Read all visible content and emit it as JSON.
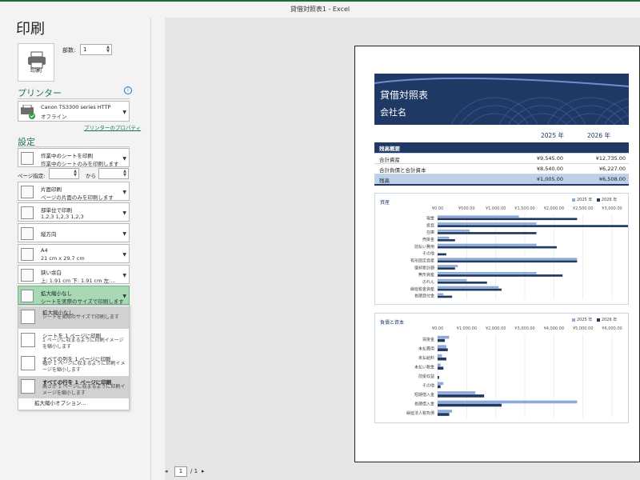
{
  "window": {
    "title": "貸借対照表1  -  Excel"
  },
  "left": {
    "heading": "印刷",
    "print_button": "印刷",
    "copies_label": "部数:",
    "copies_value": "1",
    "printer_heading": "プリンター",
    "printer_name": "Canon TS3300 series HTTP",
    "printer_status": "オフライン",
    "printer_props": "プリンターのプロパティ",
    "settings_heading": "設定",
    "pages_label": "ページ指定:",
    "pages_to": "から",
    "settings": [
      {
        "l1": "作業中のシートを印刷",
        "l2": "作業中のシートのみを印刷します"
      },
      {
        "l1": "片面印刷",
        "l2": "ページの片面のみを印刷します"
      },
      {
        "l1": "部単位で印刷",
        "l2": "1,2,3    1,2,3    1,2,3"
      },
      {
        "l1": "縦方向",
        "l2": ""
      },
      {
        "l1": "A4",
        "l2": "21 cm x 29.7 cm"
      },
      {
        "l1": "狭い余白",
        "l2": "上: 1.91 cm 下: 1.91 cm 左:…"
      },
      {
        "l1": "拡大縮小なし",
        "l2": "シートを実際のサイズで印刷します"
      }
    ],
    "scaling_menu": [
      {
        "l1": "拡大縮小なし",
        "l2": "シートを実際のサイズで印刷します"
      },
      {
        "l1": "シートを 1 ページに印刷",
        "l2": "1 ページに収まるように印刷イメージを縮小します"
      },
      {
        "l1": "すべての列を 1 ページに印刷",
        "l2": "幅が 1 ページに収まるように印刷イメージを縮小します"
      },
      {
        "l1": "すべての行を 1 ページに印刷",
        "l2": "高さが 1 ページに収まるように印刷イメージを縮小します"
      }
    ],
    "scaling_more": "拡大縮小オプション..."
  },
  "nav": {
    "page": "1",
    "of": "/ 1"
  },
  "preview": {
    "title": "貸借対照表",
    "company": "会社名",
    "year1": "2025 年",
    "year2": "2026 年",
    "table": {
      "header": "残高概要",
      "rows": [
        {
          "label": "合計資産",
          "v1": "¥9,545.00",
          "v2": "¥12,735.00"
        },
        {
          "label": "合計負債と合計資本",
          "v1": "¥8,540.00",
          "v2": "¥6,227.00"
        }
      ],
      "total": {
        "label": "残高",
        "v1": "¥1,005.00",
        "v2": "¥6,508.00"
      }
    }
  },
  "colors": {
    "light": "#8eaadb",
    "dark": "#1f3864"
  },
  "chart_data": [
    {
      "type": "bar",
      "title": "資産",
      "categories": [
        "現金",
        "投資",
        "在庫",
        "売掛金",
        "前払い費用",
        "その他",
        "有形固定資産",
        "償却累計額",
        "無形資産",
        "のれん",
        "繰延税金資産",
        "長期貸付金"
      ],
      "series": [
        {
          "name": "2025 年",
          "values": [
            1400,
            1700,
            550,
            200,
            1700,
            0,
            2400,
            350,
            1700,
            500,
            1050,
            100
          ]
        },
        {
          "name": "2026 年",
          "values": [
            2400,
            3500,
            1700,
            300,
            2050,
            150,
            2400,
            300,
            2150,
            850,
            1100,
            250
          ]
        }
      ],
      "x_ticks": [
        "¥0.00",
        "¥500.00",
        "¥1,000.00",
        "¥1,500.00",
        "¥2,000.00",
        "¥2,500.00",
        "¥3,000.00"
      ],
      "xlim": [
        0,
        3000
      ]
    },
    {
      "type": "bar",
      "title": "負債と資本",
      "categories": [
        "買掛金",
        "未払費用",
        "未払給料",
        "未払い税金",
        "前受収益",
        "その他",
        "短期借入金",
        "長期借入金",
        "繰延法人税負債"
      ],
      "series": [
        {
          "name": "2025 年",
          "values": [
            400,
            300,
            150,
            100,
            0,
            200,
            1300,
            4800,
            500
          ]
        },
        {
          "name": "2026 年",
          "values": [
            250,
            350,
            300,
            200,
            50,
            100,
            1600,
            2200,
            400
          ]
        }
      ],
      "x_ticks": [
        "¥0.00",
        "¥1,000.00",
        "¥2,000.00",
        "¥3,000.00",
        "¥4,000.00",
        "¥5,000.00",
        "¥6,000.00"
      ],
      "xlim": [
        0,
        6000
      ]
    }
  ]
}
